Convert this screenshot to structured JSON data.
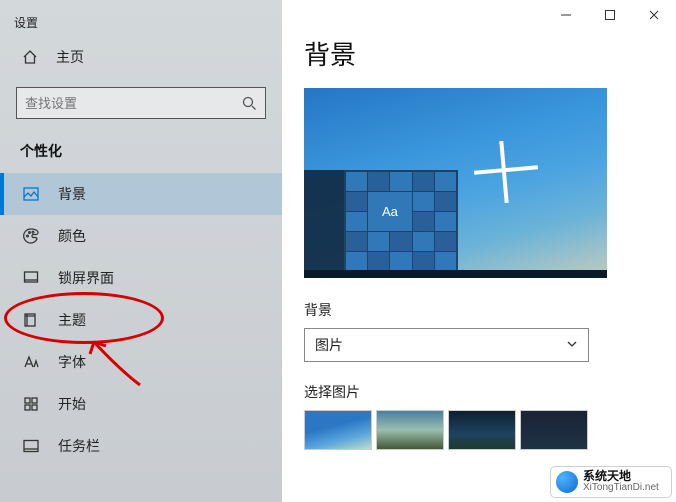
{
  "app_title": "设置",
  "home_label": "主页",
  "search_placeholder": "查找设置",
  "section_header": "个性化",
  "nav": {
    "background": "背景",
    "colors": "颜色",
    "lockscreen": "锁屏界面",
    "themes": "主题",
    "fonts": "字体",
    "start": "开始",
    "taskbar": "任务栏"
  },
  "main": {
    "title": "背景",
    "preview_sample_text": "Aa",
    "background_label": "背景",
    "background_dropdown_value": "图片",
    "choose_picture_label": "选择图片"
  },
  "watermark": {
    "name": "系统天地",
    "url": "XiTongTianDi.net"
  }
}
